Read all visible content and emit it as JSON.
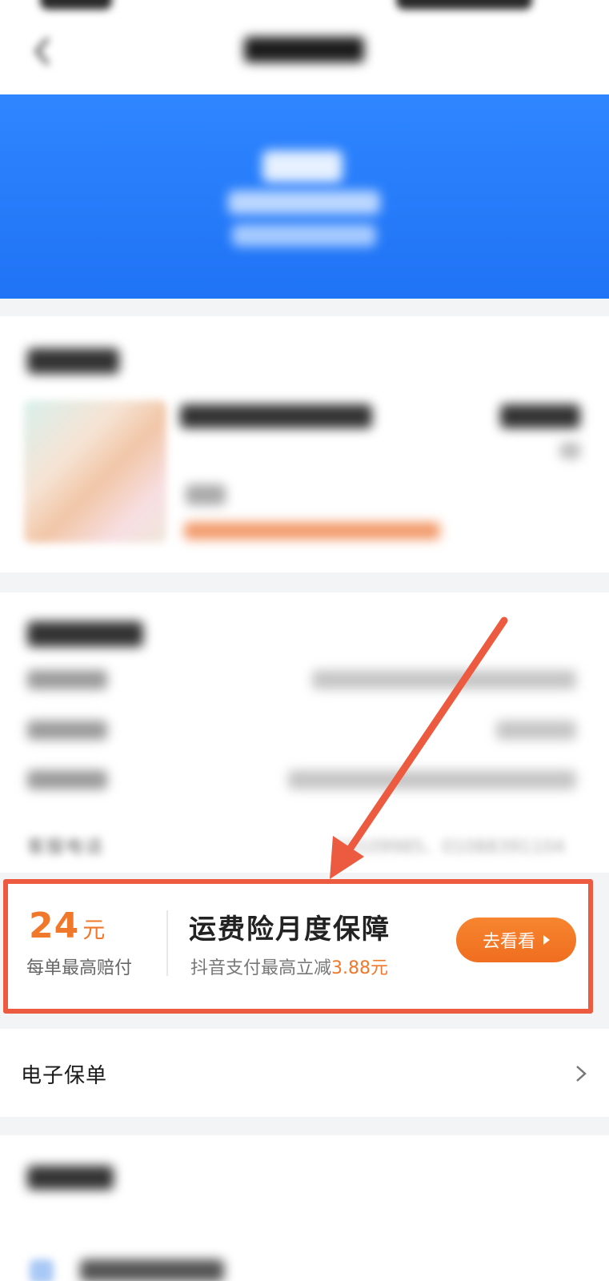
{
  "promo": {
    "amount_value": "24",
    "amount_unit": "元",
    "amount_caption": "每单最高赔付",
    "title": "运费险月度保障",
    "subtitle_prefix": "抖音支付最高立减",
    "subtitle_highlight": "3.88元",
    "button_label": "去看看"
  },
  "info": {
    "phone_label": "客服电话",
    "phone_value": "10109985、01088391104"
  },
  "policy": {
    "label": "电子保单"
  },
  "colors": {
    "accent_orange": "#f0782a",
    "banner_blue": "#2f86ff",
    "highlight_red": "#ec5a3f"
  }
}
